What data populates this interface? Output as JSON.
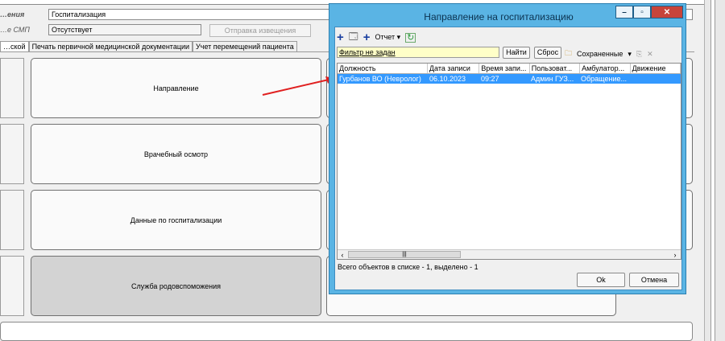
{
  "form": {
    "label_top": "…ения",
    "label_smp": "…е СМП",
    "field_type_value": "Госпитализация",
    "field_status_value": "Отсутствует",
    "send_notice_label": "Отправка извещения"
  },
  "tabs": [
    {
      "label": "…ской"
    },
    {
      "label": "Печать первичной медицинской документации"
    },
    {
      "label": "Учет перемещений пациента"
    }
  ],
  "actions": [
    {
      "label": "Направление"
    },
    {
      "label": "Врачебный осмотр"
    },
    {
      "label": "Данные по госпитализации"
    },
    {
      "label": "Служба родовспоможения"
    }
  ],
  "dialog": {
    "title": "Направление на госпитализацию",
    "toolbar": {
      "report_label": "Отчет",
      "filter_label": "Фильтр не задан",
      "find_label": "Найти",
      "reset_label": "Сброс",
      "saved_label": "Сохраненные"
    },
    "columns": [
      "Должность",
      "Дата записи",
      "Время запи...",
      "Пользоват...",
      "Амбулатор...",
      "Движение"
    ],
    "rows": [
      [
        "Гурбанов ВО (Невролог)",
        "06.10.2023",
        "09:27",
        "Админ ГУЗ...",
        "Обращение...",
        ""
      ]
    ],
    "status_text": "Всего объектов в списке - 1, выделено - 1",
    "ok_label": "Ok",
    "cancel_label": "Отмена"
  },
  "colors": {
    "dialog_frame": "#5ab4e4",
    "selection": "#3399ff",
    "close_button": "#c7443a",
    "arrow": "#e02020"
  }
}
